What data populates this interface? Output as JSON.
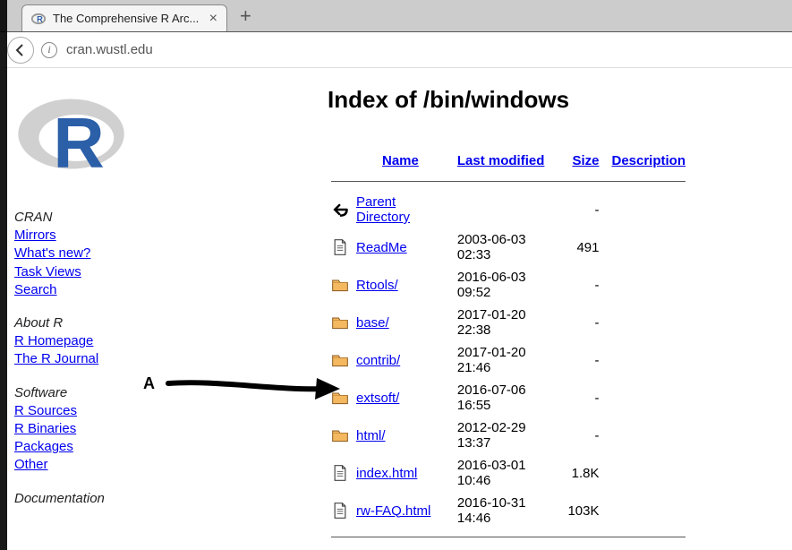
{
  "tab": {
    "title": "The Comprehensive R Arc..."
  },
  "url": "cran.wustl.edu",
  "sidebar": {
    "groups": [
      {
        "head": "CRAN",
        "links": [
          "Mirrors",
          "What's new?",
          "Task Views",
          "Search"
        ]
      },
      {
        "head": "About R",
        "links": [
          "R Homepage",
          "The R Journal"
        ]
      },
      {
        "head": "Software",
        "links": [
          "R Sources",
          "R Binaries",
          "Packages",
          "Other"
        ]
      },
      {
        "head": "Documentation",
        "links": []
      }
    ]
  },
  "page": {
    "title": "Index of /bin/windows"
  },
  "columns": {
    "name": "Name",
    "modified": "Last modified",
    "size": "Size",
    "desc": "Description"
  },
  "rows": [
    {
      "icon": "parent",
      "name": "Parent Directory",
      "modified": "",
      "size": "-",
      "desc": ""
    },
    {
      "icon": "file",
      "name": "ReadMe",
      "modified": "2003-06-03 02:33",
      "size": "491",
      "desc": ""
    },
    {
      "icon": "folder",
      "name": "Rtools/",
      "modified": "2016-06-03 09:52",
      "size": "-",
      "desc": ""
    },
    {
      "icon": "folder",
      "name": "base/",
      "modified": "2017-01-20 22:38",
      "size": "-",
      "desc": ""
    },
    {
      "icon": "folder",
      "name": "contrib/",
      "modified": "2017-01-20 21:46",
      "size": "-",
      "desc": ""
    },
    {
      "icon": "folder",
      "name": "extsoft/",
      "modified": "2016-07-06 16:55",
      "size": "-",
      "desc": ""
    },
    {
      "icon": "folder",
      "name": "html/",
      "modified": "2012-02-29 13:37",
      "size": "-",
      "desc": ""
    },
    {
      "icon": "file",
      "name": "index.html",
      "modified": "2016-03-01 10:46",
      "size": "1.8K",
      "desc": ""
    },
    {
      "icon": "file",
      "name": "rw-FAQ.html",
      "modified": "2016-10-31 14:46",
      "size": "103K",
      "desc": ""
    }
  ],
  "annotation": {
    "label": "A"
  }
}
